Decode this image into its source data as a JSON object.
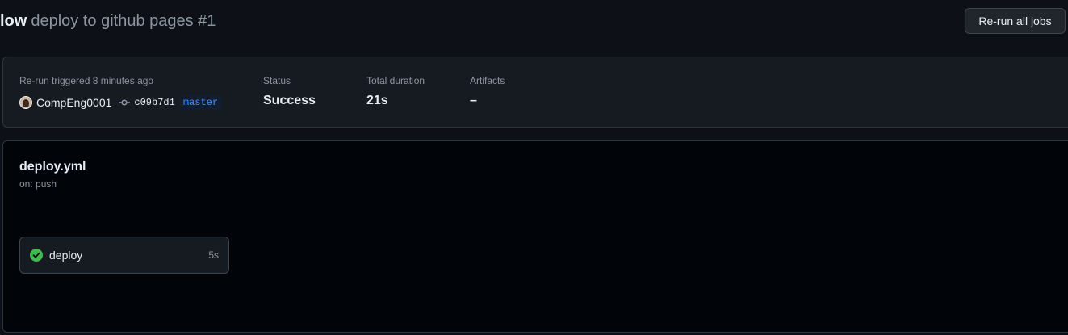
{
  "header": {
    "title_prefix": "low",
    "run_title": "deploy to github pages #1",
    "rerun_button": "Re-run all jobs"
  },
  "summary": {
    "trigger_label": "Re-run triggered 8 minutes ago",
    "actor": "CompEng0001",
    "commit_sha": "c09b7d1",
    "branch": "master",
    "status_label": "Status",
    "status_value": "Success",
    "duration_label": "Total duration",
    "duration_value": "21s",
    "artifacts_label": "Artifacts",
    "artifacts_value": "–"
  },
  "workflow": {
    "file": "deploy.yml",
    "trigger": "on: push",
    "jobs": [
      {
        "name": "deploy",
        "duration": "5s",
        "status": "success",
        "status_icon": "check-circle-fill-icon"
      }
    ]
  },
  "colors": {
    "background": "#0d1117",
    "success": "#3fb950",
    "link": "#4493f8"
  }
}
